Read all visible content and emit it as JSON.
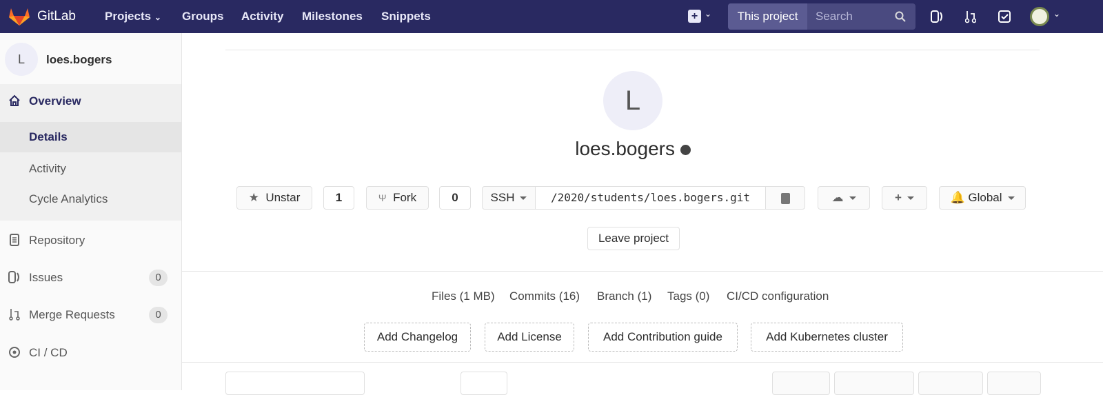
{
  "header": {
    "brand": "GitLab",
    "nav": [
      "Projects",
      "Groups",
      "Activity",
      "Milestones",
      "Snippets"
    ],
    "search_scope": "This project",
    "search_placeholder": "Search",
    "accent": "#292961"
  },
  "sidebar": {
    "avatar_letter": "L",
    "project_name": "loes.bogers",
    "items": [
      {
        "label": "Overview"
      },
      {
        "label": "Details"
      },
      {
        "label": "Activity"
      },
      {
        "label": "Cycle Analytics"
      },
      {
        "label": "Repository"
      },
      {
        "label": "Issues",
        "count": "0"
      },
      {
        "label": "Merge Requests",
        "count": "0"
      },
      {
        "label": "CI / CD"
      }
    ]
  },
  "project": {
    "avatar_letter": "L",
    "title": "loes.bogers",
    "star_label": "Unstar",
    "star_count": "1",
    "fork_label": "Fork",
    "fork_count": "0",
    "clone_protocol": "SSH",
    "clone_url": "/2020/students/loes.bogers.git",
    "notification_label": "Global",
    "leave_label": "Leave project"
  },
  "stats": [
    "Files (1 MB)",
    "Commits (16)",
    "Branch (1)",
    "Tags (0)",
    "CI/CD configuration"
  ],
  "add_buttons": [
    "Add Changelog",
    "Add License",
    "Add Contribution guide",
    "Add Kubernetes cluster"
  ]
}
